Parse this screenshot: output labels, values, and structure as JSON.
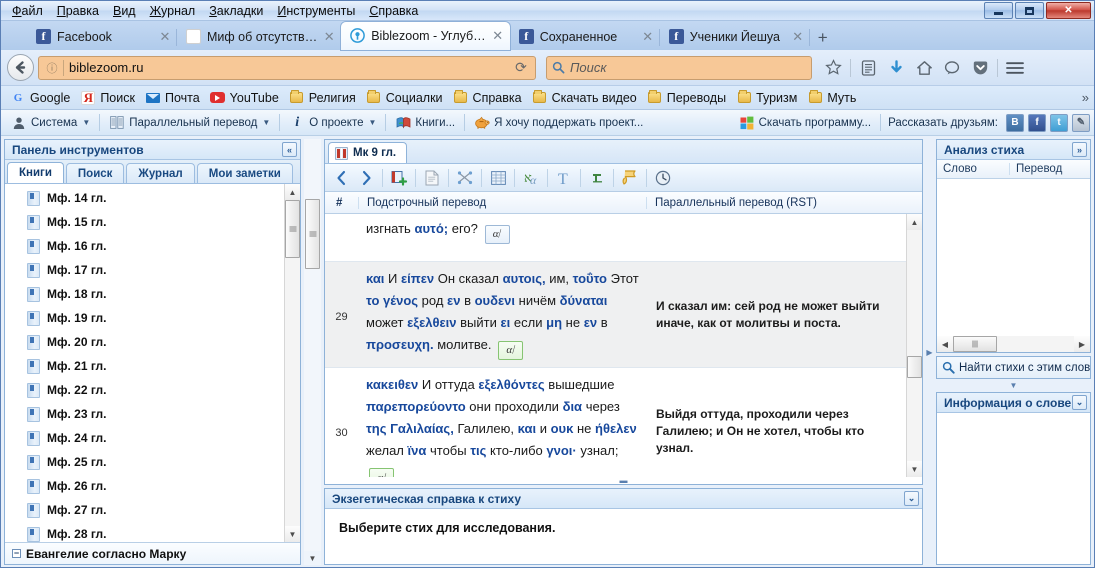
{
  "browser": {
    "menu": [
      "Файл",
      "Правка",
      "Вид",
      "Журнал",
      "Закладки",
      "Инструменты",
      "Справка"
    ],
    "window_controls": {
      "minimize": "minimize-icon",
      "maximize": "maximize-icon",
      "close": "✕"
    },
    "tabs": [
      {
        "label": "Facebook",
        "icon": "facebook-icon",
        "active": false
      },
      {
        "label": "Миф об отсутств…",
        "icon": "page-icon",
        "active": false
      },
      {
        "label": "Biblezoom - Углуб…",
        "icon": "biblezoom-icon",
        "active": true
      },
      {
        "label": "Сохраненное",
        "icon": "facebook-icon",
        "active": false
      },
      {
        "label": "Ученики Йешуа",
        "icon": "facebook-icon",
        "active": false
      }
    ],
    "new_tab_label": "+",
    "url": "biblezoom.ru",
    "search_placeholder": "Поиск",
    "nav_icons": [
      "bookmark-star-icon",
      "library-icon",
      "downloads-icon",
      "home-icon",
      "chat-icon",
      "pocket-icon",
      "menu-hamburger-icon"
    ],
    "bookmarks": [
      {
        "label": "Google",
        "icon": "google-icon"
      },
      {
        "label": "Поиск",
        "icon": "yandex-icon"
      },
      {
        "label": "Почта",
        "icon": "mail-icon"
      },
      {
        "label": "YouTube",
        "icon": "youtube-icon"
      },
      {
        "label": "Религия",
        "icon": "folder-icon"
      },
      {
        "label": "Социалки",
        "icon": "folder-icon"
      },
      {
        "label": "Справка",
        "icon": "folder-icon"
      },
      {
        "label": "Скачать видео",
        "icon": "folder-icon"
      },
      {
        "label": "Переводы",
        "icon": "folder-icon"
      },
      {
        "label": "Туризм",
        "icon": "folder-icon"
      },
      {
        "label": "Муть",
        "icon": "folder-icon"
      }
    ],
    "bookmarks_overflow": "»"
  },
  "app_toolbar": {
    "items": [
      {
        "label": "Система",
        "icon": "user-icon",
        "caret": true
      },
      {
        "label": "Параллельный перевод",
        "icon": "columns-icon",
        "caret": true
      },
      {
        "label": "О проекте",
        "icon": "info-icon",
        "caret": true
      },
      {
        "label": "Книги...",
        "icon": "books-icon",
        "caret": false
      },
      {
        "label": "Я хочу поддержать проект...",
        "icon": "piggybank-icon",
        "caret": false
      }
    ],
    "download_label": "Скачать программу...",
    "download_icon": "windows-icon",
    "share_label": "Рассказать друзьям:",
    "share_buttons": [
      "В",
      "f",
      "t",
      "✎"
    ]
  },
  "sidebar": {
    "title": "Панель инструментов",
    "collapse_icon": "«",
    "tabs": [
      {
        "label": "Книги",
        "active": true
      },
      {
        "label": "Поиск",
        "active": false
      },
      {
        "label": "Журнал",
        "active": false
      },
      {
        "label": "Мои заметки",
        "active": false
      }
    ],
    "books": [
      "Мф. 14 гл.",
      "Мф. 15 гл.",
      "Мф. 16 гл.",
      "Мф. 17 гл.",
      "Мф. 18 гл.",
      "Мф. 19 гл.",
      "Мф. 20 гл.",
      "Мф. 21 гл.",
      "Мф. 22 гл.",
      "Мф. 23 гл.",
      "Мф. 24 гл.",
      "Мф. 25 гл.",
      "Мф. 26 гл.",
      "Мф. 27 гл.",
      "Мф. 28 гл."
    ],
    "footer_item": "Евангелие согласно Марку",
    "footer_expander": "−"
  },
  "document": {
    "tab_label": "Мк 9 гл.",
    "tab_icon": "book-icon",
    "toolbar_icons": [
      "prev-arrow-icon",
      "next-arrow-icon",
      "add-book-icon",
      "page-icon",
      "cross-refs-icon",
      "table-icon",
      "greek-alpha-icon",
      "text-icon",
      "hebrew-icon",
      "scroll-icon",
      "history-clock-icon"
    ],
    "columns": {
      "num": "#",
      "interlinear": "Подстрочный перевод",
      "parallel": "Параллельный перевод (RST)"
    },
    "verses": [
      {
        "num": "",
        "clipped": true,
        "interlinear_tokens": [
          {
            "t": "изгнать",
            "g": false
          },
          {
            "t": "αυτό;",
            "g": true
          },
          {
            "t": "его?",
            "g": false
          }
        ],
        "strong_button": "α⁄",
        "strong_style": "blue",
        "parallel": ""
      },
      {
        "num": "29",
        "clipped": false,
        "interlinear_tokens": [
          {
            "t": "και",
            "g": true
          },
          {
            "t": "И",
            "g": false
          },
          {
            "t": "είπεν",
            "g": true
          },
          {
            "t": "Он сказал",
            "g": false
          },
          {
            "t": "αυτοις,",
            "g": true
          },
          {
            "t": "им,",
            "g": false
          },
          {
            "t": "τοΰτο",
            "g": true
          },
          {
            "t": "Этот",
            "g": false
          },
          {
            "t": "το γένος",
            "g": true
          },
          {
            "t": "род",
            "g": false
          },
          {
            "t": "εν",
            "g": true
          },
          {
            "t": "в",
            "g": false
          },
          {
            "t": "ουδενι",
            "g": true
          },
          {
            "t": "ничём",
            "g": false
          },
          {
            "t": "δύναται",
            "g": true
          },
          {
            "t": "может",
            "g": false
          },
          {
            "t": "εξελθειν",
            "g": true
          },
          {
            "t": "выйти",
            "g": false
          },
          {
            "t": "ει",
            "g": true
          },
          {
            "t": "если",
            "g": false
          },
          {
            "t": "μη",
            "g": true
          },
          {
            "t": "не",
            "g": false
          },
          {
            "t": "εν",
            "g": true
          },
          {
            "t": "в",
            "g": false
          },
          {
            "t": "προσευχη.",
            "g": true
          },
          {
            "t": "молитве.",
            "g": false
          }
        ],
        "strong_button": "α⁄",
        "strong_style": "green",
        "parallel": "И сказал им: сей род не может выйти иначе, как от молитвы и поста."
      },
      {
        "num": "30",
        "clipped": false,
        "interlinear_tokens": [
          {
            "t": "κακειθεν",
            "g": true
          },
          {
            "t": "И оттуда",
            "g": false
          },
          {
            "t": "εξελθόντες",
            "g": true
          },
          {
            "t": "вышедшие",
            "g": false
          },
          {
            "t": "παρεπορεύοντο",
            "g": true
          },
          {
            "t": "они проходили",
            "g": false
          },
          {
            "t": "δια",
            "g": true
          },
          {
            "t": "через",
            "g": false
          },
          {
            "t": "της Γαλιλαίας,",
            "g": true
          },
          {
            "t": "Галилею,",
            "g": false
          },
          {
            "t": "και",
            "g": true
          },
          {
            "t": "и",
            "g": false
          },
          {
            "t": "ουκ",
            "g": true
          },
          {
            "t": "не",
            "g": false
          },
          {
            "t": "ήθελεν",
            "g": true
          },
          {
            "t": "желал",
            "g": false
          },
          {
            "t": "ϊνα",
            "g": true
          },
          {
            "t": "чтобы",
            "g": false
          },
          {
            "t": "τις",
            "g": true
          },
          {
            "t": "кто-либо",
            "g": false
          },
          {
            "t": "γνοι·",
            "g": true
          },
          {
            "t": "узнал;",
            "g": false
          }
        ],
        "strong_button": "α⁄",
        "strong_style": "green",
        "parallel": "Выйдя оттуда, проходили через Галилею; и Он не хотел, чтобы кто узнал."
      }
    ]
  },
  "exegesis": {
    "title": "Экзегетическая справка к стиху",
    "expand_icon": "⌄",
    "body": "Выберите стих для исследования."
  },
  "right_panel": {
    "analysis_title": "Анализ стиха",
    "analysis_expand_icon": "»",
    "columns": {
      "word": "Слово",
      "translation": "Перевод"
    },
    "find_label": "Найти стихи с этим слов",
    "find_icon": "search-icon",
    "word_info_title": "Информация о слове",
    "word_info_icon": "⌄"
  }
}
